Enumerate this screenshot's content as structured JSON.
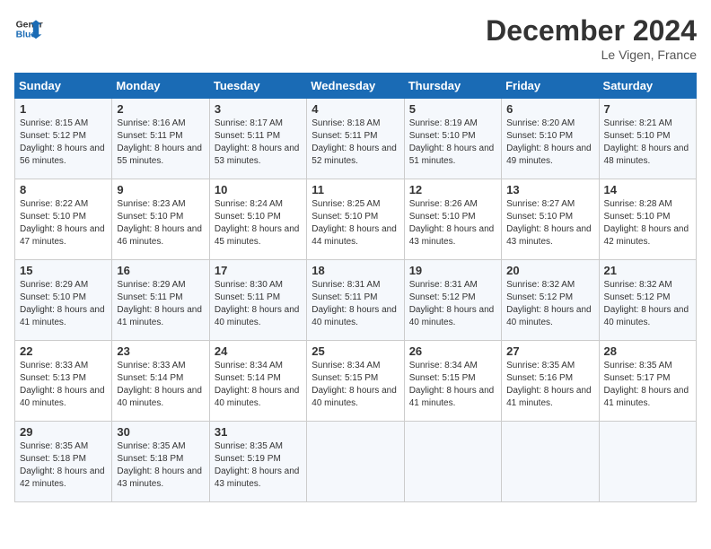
{
  "header": {
    "logo_line1": "General",
    "logo_line2": "Blue",
    "month": "December 2024",
    "location": "Le Vigen, France"
  },
  "days_of_week": [
    "Sunday",
    "Monday",
    "Tuesday",
    "Wednesday",
    "Thursday",
    "Friday",
    "Saturday"
  ],
  "weeks": [
    [
      {
        "day": 1,
        "sunrise": "8:15 AM",
        "sunset": "5:12 PM",
        "daylight": "8 hours and 56 minutes."
      },
      {
        "day": 2,
        "sunrise": "8:16 AM",
        "sunset": "5:11 PM",
        "daylight": "8 hours and 55 minutes."
      },
      {
        "day": 3,
        "sunrise": "8:17 AM",
        "sunset": "5:11 PM",
        "daylight": "8 hours and 53 minutes."
      },
      {
        "day": 4,
        "sunrise": "8:18 AM",
        "sunset": "5:11 PM",
        "daylight": "8 hours and 52 minutes."
      },
      {
        "day": 5,
        "sunrise": "8:19 AM",
        "sunset": "5:10 PM",
        "daylight": "8 hours and 51 minutes."
      },
      {
        "day": 6,
        "sunrise": "8:20 AM",
        "sunset": "5:10 PM",
        "daylight": "8 hours and 49 minutes."
      },
      {
        "day": 7,
        "sunrise": "8:21 AM",
        "sunset": "5:10 PM",
        "daylight": "8 hours and 48 minutes."
      }
    ],
    [
      {
        "day": 8,
        "sunrise": "8:22 AM",
        "sunset": "5:10 PM",
        "daylight": "8 hours and 47 minutes."
      },
      {
        "day": 9,
        "sunrise": "8:23 AM",
        "sunset": "5:10 PM",
        "daylight": "8 hours and 46 minutes."
      },
      {
        "day": 10,
        "sunrise": "8:24 AM",
        "sunset": "5:10 PM",
        "daylight": "8 hours and 45 minutes."
      },
      {
        "day": 11,
        "sunrise": "8:25 AM",
        "sunset": "5:10 PM",
        "daylight": "8 hours and 44 minutes."
      },
      {
        "day": 12,
        "sunrise": "8:26 AM",
        "sunset": "5:10 PM",
        "daylight": "8 hours and 43 minutes."
      },
      {
        "day": 13,
        "sunrise": "8:27 AM",
        "sunset": "5:10 PM",
        "daylight": "8 hours and 43 minutes."
      },
      {
        "day": 14,
        "sunrise": "8:28 AM",
        "sunset": "5:10 PM",
        "daylight": "8 hours and 42 minutes."
      }
    ],
    [
      {
        "day": 15,
        "sunrise": "8:29 AM",
        "sunset": "5:10 PM",
        "daylight": "8 hours and 41 minutes."
      },
      {
        "day": 16,
        "sunrise": "8:29 AM",
        "sunset": "5:11 PM",
        "daylight": "8 hours and 41 minutes."
      },
      {
        "day": 17,
        "sunrise": "8:30 AM",
        "sunset": "5:11 PM",
        "daylight": "8 hours and 40 minutes."
      },
      {
        "day": 18,
        "sunrise": "8:31 AM",
        "sunset": "5:11 PM",
        "daylight": "8 hours and 40 minutes."
      },
      {
        "day": 19,
        "sunrise": "8:31 AM",
        "sunset": "5:12 PM",
        "daylight": "8 hours and 40 minutes."
      },
      {
        "day": 20,
        "sunrise": "8:32 AM",
        "sunset": "5:12 PM",
        "daylight": "8 hours and 40 minutes."
      },
      {
        "day": 21,
        "sunrise": "8:32 AM",
        "sunset": "5:12 PM",
        "daylight": "8 hours and 40 minutes."
      }
    ],
    [
      {
        "day": 22,
        "sunrise": "8:33 AM",
        "sunset": "5:13 PM",
        "daylight": "8 hours and 40 minutes."
      },
      {
        "day": 23,
        "sunrise": "8:33 AM",
        "sunset": "5:14 PM",
        "daylight": "8 hours and 40 minutes."
      },
      {
        "day": 24,
        "sunrise": "8:34 AM",
        "sunset": "5:14 PM",
        "daylight": "8 hours and 40 minutes."
      },
      {
        "day": 25,
        "sunrise": "8:34 AM",
        "sunset": "5:15 PM",
        "daylight": "8 hours and 40 minutes."
      },
      {
        "day": 26,
        "sunrise": "8:34 AM",
        "sunset": "5:15 PM",
        "daylight": "8 hours and 41 minutes."
      },
      {
        "day": 27,
        "sunrise": "8:35 AM",
        "sunset": "5:16 PM",
        "daylight": "8 hours and 41 minutes."
      },
      {
        "day": 28,
        "sunrise": "8:35 AM",
        "sunset": "5:17 PM",
        "daylight": "8 hours and 41 minutes."
      }
    ],
    [
      {
        "day": 29,
        "sunrise": "8:35 AM",
        "sunset": "5:18 PM",
        "daylight": "8 hours and 42 minutes."
      },
      {
        "day": 30,
        "sunrise": "8:35 AM",
        "sunset": "5:18 PM",
        "daylight": "8 hours and 43 minutes."
      },
      {
        "day": 31,
        "sunrise": "8:35 AM",
        "sunset": "5:19 PM",
        "daylight": "8 hours and 43 minutes."
      },
      null,
      null,
      null,
      null
    ]
  ],
  "labels": {
    "sunrise": "Sunrise:",
    "sunset": "Sunset:",
    "daylight": "Daylight:"
  }
}
